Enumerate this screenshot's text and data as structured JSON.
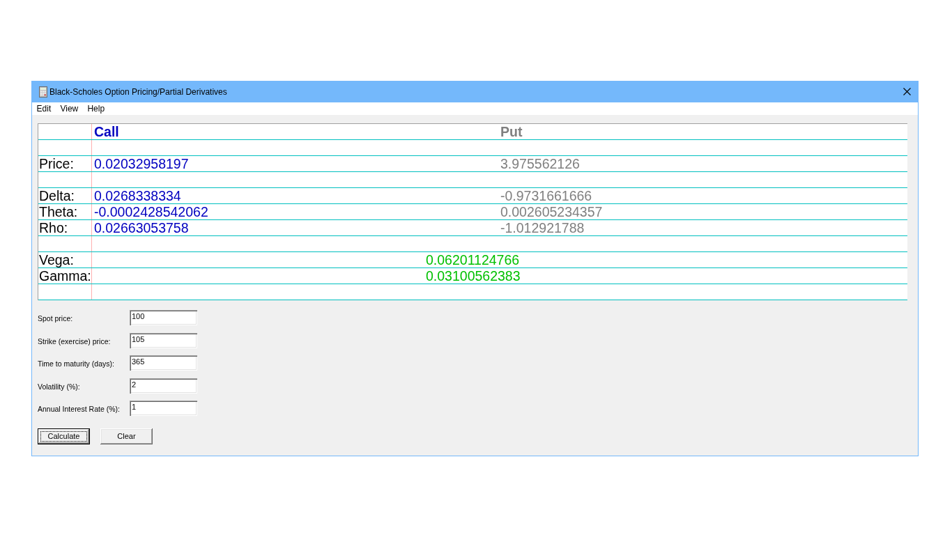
{
  "window": {
    "title": "Black-Scholes Option Pricing/Partial Derivatives"
  },
  "menu": [
    {
      "label": "Edit"
    },
    {
      "label": "View"
    },
    {
      "label": "Help"
    }
  ],
  "results_table": {
    "columns": [
      {
        "label": "Call",
        "color": "#0000c0"
      },
      {
        "label": "Put",
        "color": "#808080"
      }
    ],
    "rows": [
      {
        "kind": "blank"
      },
      {
        "kind": "pair",
        "label": "Price:",
        "values": [
          "0.02032958197",
          "3.975562126"
        ]
      },
      {
        "kind": "blank"
      },
      {
        "kind": "pair",
        "label": "Delta:",
        "values": [
          "0.0268338334",
          "-0.9731661666"
        ]
      },
      {
        "kind": "pair",
        "label": "Theta:",
        "values": [
          "-0.0002428542062",
          "0.002605234357"
        ]
      },
      {
        "kind": "pair",
        "label": "Rho:",
        "values": [
          "0.02663053758",
          "-1.012921788"
        ]
      },
      {
        "kind": "blank"
      },
      {
        "kind": "shared",
        "label": "Vega:",
        "value": "0.06201124766",
        "color": "#00c000"
      },
      {
        "kind": "shared",
        "label": "Gamma:",
        "value": "0.03100562383",
        "color": "#00c000"
      },
      {
        "kind": "blank"
      }
    ]
  },
  "inputs": [
    {
      "label": "Spot price:",
      "value": "100"
    },
    {
      "label": "Strike (exercise) price:",
      "value": "105"
    },
    {
      "label": "Time to maturity (days):",
      "value": "365"
    },
    {
      "label": "Volatility (%):",
      "value": "2"
    },
    {
      "label": "Annual Interest Rate (%):",
      "value": "1"
    }
  ],
  "buttons": [
    {
      "label": "Calculate",
      "focused": true
    },
    {
      "label": "Clear",
      "focused": false
    }
  ]
}
